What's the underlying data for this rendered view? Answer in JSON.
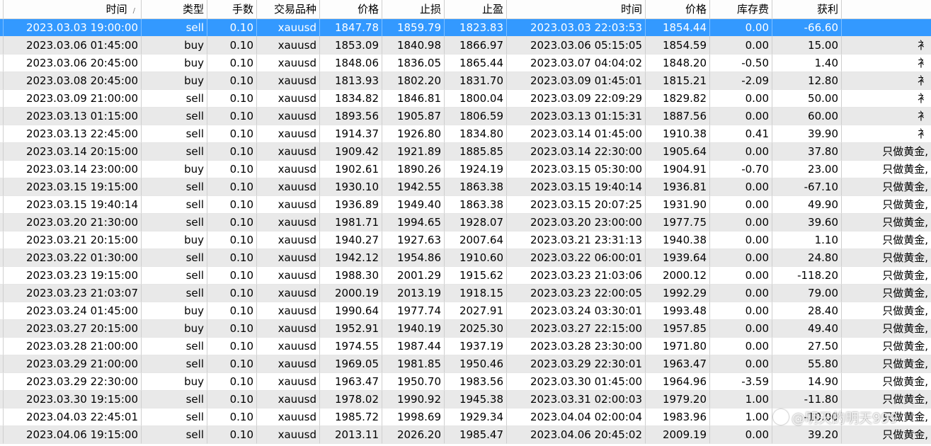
{
  "headers": {
    "open_time": "时间",
    "type": "类型",
    "lots": "手数",
    "symbol": "交易品种",
    "open_price": "价格",
    "sl": "止损",
    "tp": "止盈",
    "close_time": "时间",
    "close_price": "价格",
    "swap": "库存费",
    "profit": "获利",
    "comment": "",
    "sort_indicator": "/"
  },
  "rows": [
    {
      "open_time": "2023.03.03 19:00:00",
      "type": "sell",
      "lots": "0.10",
      "symbol": "xauusd",
      "open_price": "1847.78",
      "sl": "1859.79",
      "tp": "1823.83",
      "close_time": "2023.03.03 22:03:53",
      "close_price": "1854.44",
      "swap": "0.00",
      "profit": "-66.60",
      "comment": ""
    },
    {
      "open_time": "2023.03.06 01:45:00",
      "type": "buy",
      "lots": "0.10",
      "symbol": "xauusd",
      "open_price": "1853.09",
      "sl": "1840.98",
      "tp": "1866.97",
      "close_time": "2023.03.06 05:15:05",
      "close_price": "1854.59",
      "swap": "0.00",
      "profit": "15.00",
      "comment": "衤"
    },
    {
      "open_time": "2023.03.06 20:45:00",
      "type": "buy",
      "lots": "0.10",
      "symbol": "xauusd",
      "open_price": "1848.06",
      "sl": "1836.05",
      "tp": "1865.44",
      "close_time": "2023.03.07 04:04:02",
      "close_price": "1848.20",
      "swap": "-0.50",
      "profit": "1.40",
      "comment": "衤"
    },
    {
      "open_time": "2023.03.08 20:45:00",
      "type": "buy",
      "lots": "0.10",
      "symbol": "xauusd",
      "open_price": "1813.93",
      "sl": "1802.20",
      "tp": "1831.70",
      "close_time": "2023.03.09 01:45:01",
      "close_price": "1815.21",
      "swap": "-2.09",
      "profit": "12.80",
      "comment": "衤"
    },
    {
      "open_time": "2023.03.09 21:00:00",
      "type": "sell",
      "lots": "0.10",
      "symbol": "xauusd",
      "open_price": "1834.82",
      "sl": "1846.81",
      "tp": "1800.04",
      "close_time": "2023.03.09 22:09:29",
      "close_price": "1829.82",
      "swap": "0.00",
      "profit": "50.00",
      "comment": "衤"
    },
    {
      "open_time": "2023.03.13 01:15:00",
      "type": "sell",
      "lots": "0.10",
      "symbol": "xauusd",
      "open_price": "1893.56",
      "sl": "1905.87",
      "tp": "1806.59",
      "close_time": "2023.03.13 01:15:31",
      "close_price": "1887.56",
      "swap": "0.00",
      "profit": "60.00",
      "comment": "衤"
    },
    {
      "open_time": "2023.03.13 22:45:00",
      "type": "sell",
      "lots": "0.10",
      "symbol": "xauusd",
      "open_price": "1914.37",
      "sl": "1926.80",
      "tp": "1834.80",
      "close_time": "2023.03.14 01:45:00",
      "close_price": "1910.38",
      "swap": "0.41",
      "profit": "39.90",
      "comment": "衤"
    },
    {
      "open_time": "2023.03.14 20:15:00",
      "type": "sell",
      "lots": "0.10",
      "symbol": "xauusd",
      "open_price": "1909.42",
      "sl": "1921.89",
      "tp": "1885.85",
      "close_time": "2023.03.14 22:30:00",
      "close_price": "1905.64",
      "swap": "0.00",
      "profit": "37.80",
      "comment": "只做黄金,"
    },
    {
      "open_time": "2023.03.14 23:00:00",
      "type": "buy",
      "lots": "0.10",
      "symbol": "xauusd",
      "open_price": "1902.61",
      "sl": "1890.26",
      "tp": "1924.19",
      "close_time": "2023.03.15 05:30:00",
      "close_price": "1904.91",
      "swap": "-0.70",
      "profit": "23.00",
      "comment": "只做黄金,"
    },
    {
      "open_time": "2023.03.15 19:15:00",
      "type": "sell",
      "lots": "0.10",
      "symbol": "xauusd",
      "open_price": "1930.10",
      "sl": "1942.55",
      "tp": "1863.38",
      "close_time": "2023.03.15 19:40:14",
      "close_price": "1936.81",
      "swap": "0.00",
      "profit": "-67.10",
      "comment": "只做黄金,"
    },
    {
      "open_time": "2023.03.15 19:40:14",
      "type": "sell",
      "lots": "0.10",
      "symbol": "xauusd",
      "open_price": "1936.89",
      "sl": "1949.40",
      "tp": "1863.38",
      "close_time": "2023.03.15 20:07:25",
      "close_price": "1931.90",
      "swap": "0.00",
      "profit": "49.90",
      "comment": "只做黄金,"
    },
    {
      "open_time": "2023.03.20 21:30:00",
      "type": "sell",
      "lots": "0.10",
      "symbol": "xauusd",
      "open_price": "1981.71",
      "sl": "1994.65",
      "tp": "1928.07",
      "close_time": "2023.03.20 23:00:00",
      "close_price": "1977.75",
      "swap": "0.00",
      "profit": "39.60",
      "comment": "只做黄金,"
    },
    {
      "open_time": "2023.03.21 20:15:00",
      "type": "buy",
      "lots": "0.10",
      "symbol": "xauusd",
      "open_price": "1940.27",
      "sl": "1927.63",
      "tp": "2007.64",
      "close_time": "2023.03.21 23:31:13",
      "close_price": "1940.38",
      "swap": "0.00",
      "profit": "1.10",
      "comment": "只做黄金,"
    },
    {
      "open_time": "2023.03.22 01:30:00",
      "type": "sell",
      "lots": "0.10",
      "symbol": "xauusd",
      "open_price": "1942.12",
      "sl": "1954.86",
      "tp": "1910.60",
      "close_time": "2023.03.22 06:00:01",
      "close_price": "1939.64",
      "swap": "0.00",
      "profit": "24.80",
      "comment": "只做黄金,"
    },
    {
      "open_time": "2023.03.23 19:15:00",
      "type": "sell",
      "lots": "0.10",
      "symbol": "xauusd",
      "open_price": "1988.30",
      "sl": "2001.29",
      "tp": "1915.62",
      "close_time": "2023.03.23 21:03:06",
      "close_price": "2000.12",
      "swap": "0.00",
      "profit": "-118.20",
      "comment": "只做黄金,"
    },
    {
      "open_time": "2023.03.23 21:03:07",
      "type": "sell",
      "lots": "0.10",
      "symbol": "xauusd",
      "open_price": "2000.19",
      "sl": "2013.19",
      "tp": "1918.15",
      "close_time": "2023.03.23 22:00:05",
      "close_price": "1992.29",
      "swap": "0.00",
      "profit": "79.00",
      "comment": "只做黄金,"
    },
    {
      "open_time": "2023.03.24 01:45:00",
      "type": "buy",
      "lots": "0.10",
      "symbol": "xauusd",
      "open_price": "1990.64",
      "sl": "1977.74",
      "tp": "2027.91",
      "close_time": "2023.03.24 03:30:01",
      "close_price": "1993.48",
      "swap": "0.00",
      "profit": "28.40",
      "comment": "只做黄金,"
    },
    {
      "open_time": "2023.03.27 20:15:00",
      "type": "buy",
      "lots": "0.10",
      "symbol": "xauusd",
      "open_price": "1952.91",
      "sl": "1940.19",
      "tp": "2025.30",
      "close_time": "2023.03.27 22:15:00",
      "close_price": "1957.85",
      "swap": "0.00",
      "profit": "49.40",
      "comment": "只做黄金,"
    },
    {
      "open_time": "2023.03.28 21:00:00",
      "type": "sell",
      "lots": "0.10",
      "symbol": "xauusd",
      "open_price": "1974.55",
      "sl": "1987.44",
      "tp": "1937.19",
      "close_time": "2023.03.28 23:30:00",
      "close_price": "1971.80",
      "swap": "0.00",
      "profit": "27.50",
      "comment": "只做黄金,"
    },
    {
      "open_time": "2023.03.29 21:00:00",
      "type": "sell",
      "lots": "0.10",
      "symbol": "xauusd",
      "open_price": "1969.05",
      "sl": "1981.85",
      "tp": "1950.46",
      "close_time": "2023.03.29 22:30:01",
      "close_price": "1963.47",
      "swap": "0.00",
      "profit": "55.80",
      "comment": "只做黄金,"
    },
    {
      "open_time": "2023.03.29 22:30:00",
      "type": "buy",
      "lots": "0.10",
      "symbol": "xauusd",
      "open_price": "1963.47",
      "sl": "1950.70",
      "tp": "1983.56",
      "close_time": "2023.03.30 01:45:00",
      "close_price": "1964.96",
      "swap": "-3.59",
      "profit": "14.90",
      "comment": "只做黄金,"
    },
    {
      "open_time": "2023.03.30 19:15:00",
      "type": "sell",
      "lots": "0.10",
      "symbol": "xauusd",
      "open_price": "1978.02",
      "sl": "1990.92",
      "tp": "1945.38",
      "close_time": "2023.03.31 02:00:03",
      "close_price": "1979.20",
      "swap": "1.00",
      "profit": "-11.80",
      "comment": "只做黄金,"
    },
    {
      "open_time": "2023.04.03 22:45:01",
      "type": "sell",
      "lots": "0.10",
      "symbol": "xauusd",
      "open_price": "1985.72",
      "sl": "1998.69",
      "tp": "1929.34",
      "close_time": "2023.04.04 02:00:04",
      "close_price": "1983.96",
      "swap": "1.00",
      "profit": "-10.00",
      "comment": "只做黄金,"
    },
    {
      "open_time": "2023.04.06 19:15:00",
      "type": "sell",
      "lots": "0.10",
      "symbol": "xauusd",
      "open_price": "2013.11",
      "sl": "2026.20",
      "tp": "1985.47",
      "close_time": "2023.04.06 20:45:02",
      "close_price": "2009.19",
      "swap": "0.00",
      "profit": "39.20",
      "comment": "只做黄金,"
    }
  ],
  "selected_row": 0,
  "watermark": "@明天的明天999"
}
